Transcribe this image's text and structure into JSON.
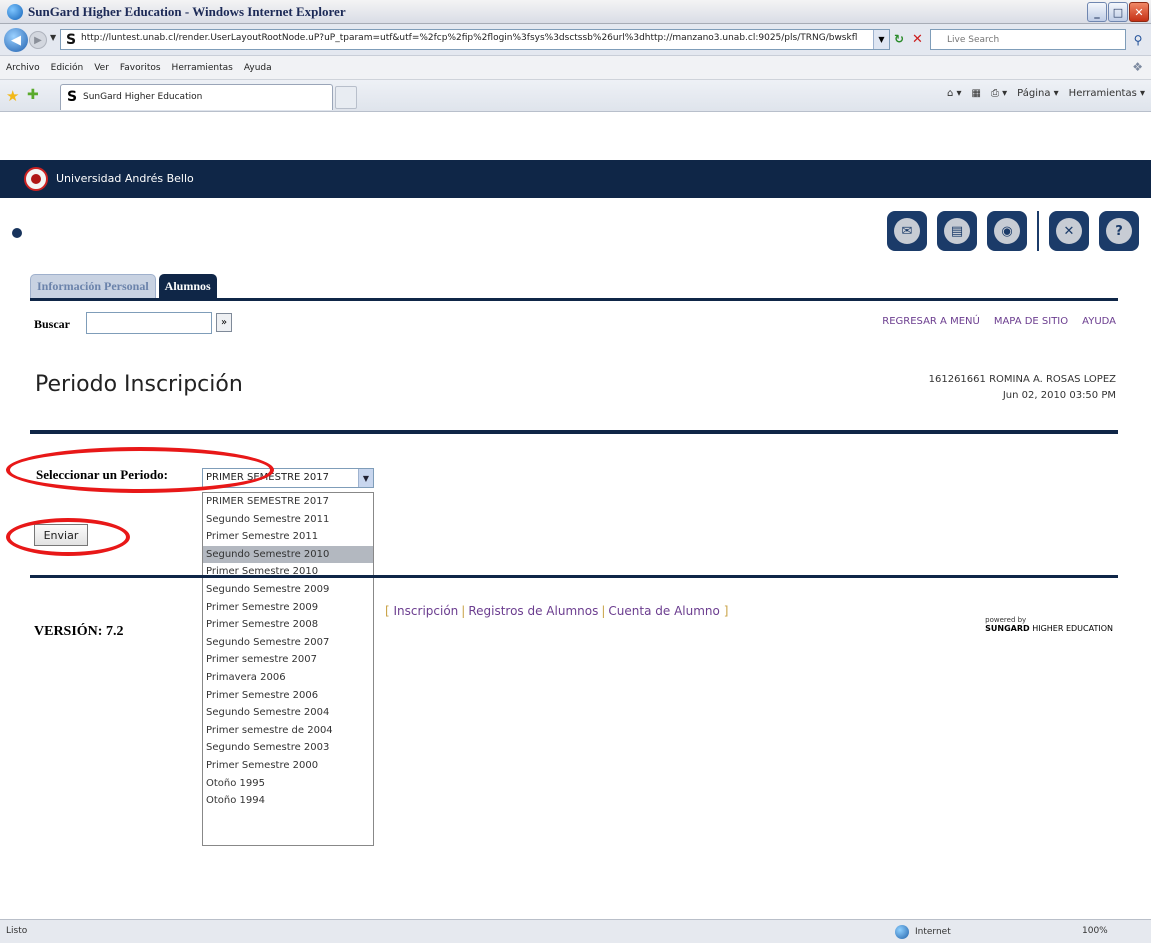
{
  "window": {
    "title": "SunGard Higher Education - Windows Internet Explorer",
    "minimize": "_",
    "maximize": "□",
    "close": "✕"
  },
  "addressbar": {
    "url": "http://luntest.unab.cl/render.UserLayoutRootNode.uP?uP_tparam=utf&utf=%2fcp%2fip%2flogin%3fsys%3dsctssb%26url%3dhttp://manzano3.unab.cl:9025/pls/TRNG/bwskfl",
    "search_placeholder": "Live Search"
  },
  "menu": [
    "Archivo",
    "Edición",
    "Ver",
    "Favoritos",
    "Herramientas",
    "Ayuda"
  ],
  "browser_tab": {
    "label": "SunGard Higher Education"
  },
  "command_bar": [
    "Página ▾",
    "Herramientas ▾"
  ],
  "banner": {
    "university": "Universidad Andrés Bello"
  },
  "nav_tabs": [
    {
      "label": "Información Personal",
      "active": false
    },
    {
      "label": "Alumnos",
      "active": true
    }
  ],
  "search": {
    "label": "Buscar",
    "value": "",
    "button": "»"
  },
  "top_links": [
    "REGRESAR A MENÚ",
    "MAPA DE SITIO",
    "AYUDA"
  ],
  "page": {
    "title": "Periodo Inscripción",
    "student_line1": "161261661 ROMINA A. ROSAS LOPEZ",
    "student_line2": "Jun 02, 2010 03:50 PM"
  },
  "period": {
    "label": "Seleccionar un Periodo:",
    "selected": "PRIMER SEMESTRE 2017",
    "highlighted": "Segundo Semestre 2010",
    "options": [
      "PRIMER SEMESTRE 2017",
      "Segundo Semestre 2011",
      "Primer Semestre 2011",
      "Segundo Semestre 2010",
      "Primer Semestre 2010",
      "Segundo Semestre 2009",
      "Primer Semestre 2009",
      "Primer Semestre 2008",
      "Segundo Semestre 2007",
      "Primer semestre 2007",
      "Primavera 2006",
      "Primer Semestre 2006",
      "Segundo Semestre 2004",
      "Primer semestre de 2004",
      "Segundo Semestre 2003",
      "Primer Semestre 2000",
      "Otoño 1995",
      "Otoño 1994"
    ]
  },
  "submit": {
    "label": "Enviar"
  },
  "footer": {
    "links": [
      "Inscripción",
      "Registros de Alumnos",
      "Cuenta de Alumno"
    ],
    "bracket_open": "[",
    "bracket_close": "]",
    "version": "VERSIÓN: 7.2",
    "powered_by": "powered by",
    "brand": "SUNGARD",
    "brand_suffix": "HIGHER EDUCATION"
  },
  "statusbar": {
    "text": "Listo",
    "zone": "Internet",
    "zoom": "100%"
  },
  "colors": {
    "navy": "#0f2647",
    "link_purple": "#6b3d8f",
    "annotation_red": "#e81818"
  }
}
